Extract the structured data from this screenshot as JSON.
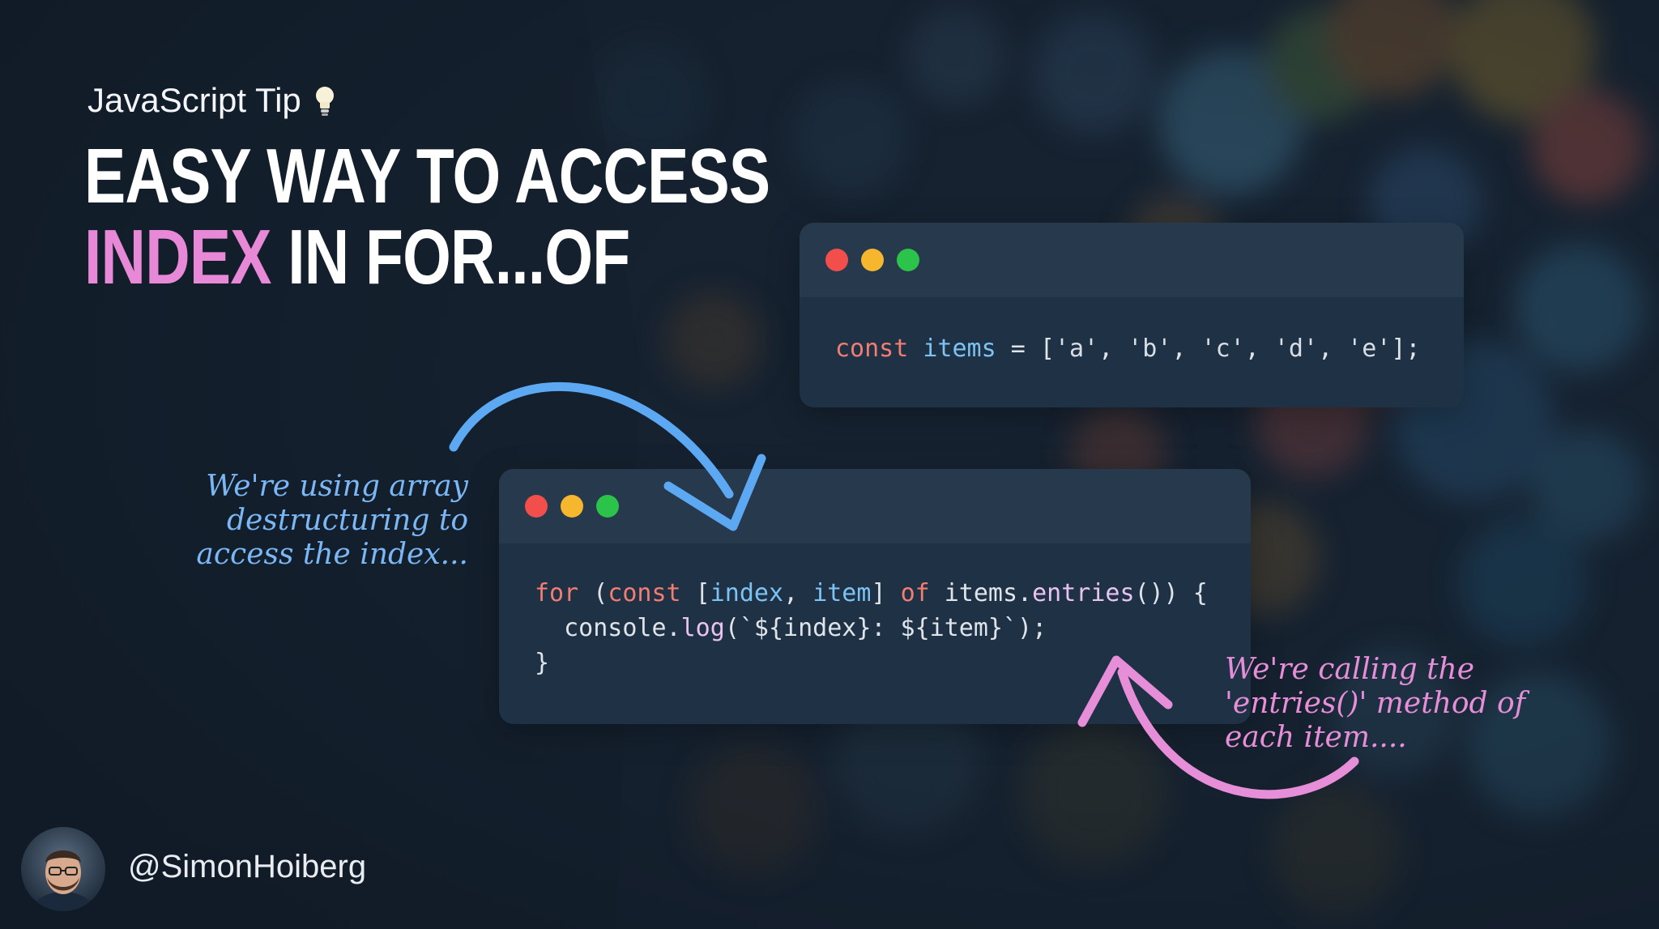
{
  "eyebrow": {
    "text": "JavaScript Tip",
    "icon": "lightbulb-icon"
  },
  "title": {
    "line1": "EASY WAY TO ACCESS",
    "highlight": "INDEX",
    "line2_rest": "IN FOR...OF"
  },
  "window_top": {
    "code_tokens": [
      {
        "t": "const",
        "c": "kw"
      },
      {
        "t": " ",
        "c": "plain"
      },
      {
        "t": "items",
        "c": "id"
      },
      {
        "t": " = [",
        "c": "plain"
      },
      {
        "t": "'a'",
        "c": "str"
      },
      {
        "t": ", ",
        "c": "plain"
      },
      {
        "t": "'b'",
        "c": "str"
      },
      {
        "t": ", ",
        "c": "plain"
      },
      {
        "t": "'c'",
        "c": "str"
      },
      {
        "t": ", ",
        "c": "plain"
      },
      {
        "t": "'d'",
        "c": "str"
      },
      {
        "t": ", ",
        "c": "plain"
      },
      {
        "t": "'e'",
        "c": "str"
      },
      {
        "t": "];",
        "c": "plain"
      }
    ]
  },
  "window_bottom": {
    "lines": [
      [
        {
          "t": "for",
          "c": "kw"
        },
        {
          "t": " (",
          "c": "plain"
        },
        {
          "t": "const",
          "c": "kw"
        },
        {
          "t": " [",
          "c": "plain"
        },
        {
          "t": "index",
          "c": "id"
        },
        {
          "t": ", ",
          "c": "plain"
        },
        {
          "t": "item",
          "c": "id"
        },
        {
          "t": "] ",
          "c": "plain"
        },
        {
          "t": "of",
          "c": "kw"
        },
        {
          "t": " items.",
          "c": "plain"
        },
        {
          "t": "entries",
          "c": "fn"
        },
        {
          "t": "()) {",
          "c": "plain"
        }
      ],
      [
        {
          "t": "  console.",
          "c": "plain"
        },
        {
          "t": "log",
          "c": "fn"
        },
        {
          "t": "(`${index}: ${item}`);",
          "c": "plain"
        }
      ],
      [
        {
          "t": "}",
          "c": "plain"
        }
      ]
    ]
  },
  "annotations": {
    "left": "We're using array destructuring to access the index...",
    "right": "We're calling the 'entries()' method of each item...."
  },
  "author": {
    "handle": "@SimonHoiberg",
    "avatar": "avatar"
  },
  "colors": {
    "background": "#152131",
    "accent_pink": "#e789d6",
    "accent_blue": "#7ab7f4",
    "window_bg": "#1f3144",
    "window_bar": "#27394d"
  }
}
